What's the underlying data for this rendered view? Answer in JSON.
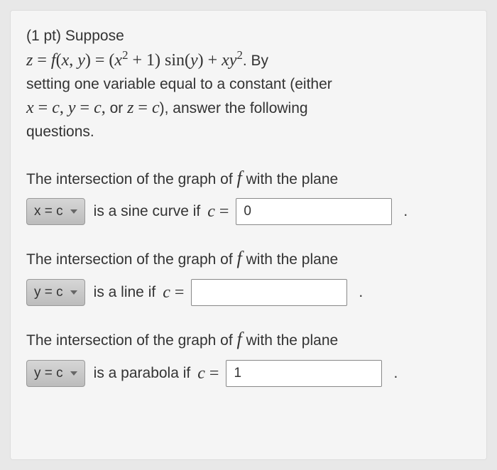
{
  "problem": {
    "prefix": "(1 pt) Suppose",
    "equation_display": "z = f(x, y) = (x² + 1) sin(y) + xy²",
    "after_eq": ". By",
    "line2a": "setting one variable equal to a constant (either",
    "constants_text": "x = c, y = c, or z = c",
    "line2b": "), answer the following",
    "line3": "questions."
  },
  "questions": [
    {
      "intro_a": "The intersection of the graph of ",
      "intro_b": " with the plane",
      "dropdown": "x = c",
      "condition": "is a sine curve if ",
      "c_eq": "c =",
      "value": "0"
    },
    {
      "intro_a": "The intersection of the graph of ",
      "intro_b": " with the plane",
      "dropdown": "y = c",
      "condition": "is a line if ",
      "c_eq": "c =",
      "value": ""
    },
    {
      "intro_a": "The intersection of the graph of ",
      "intro_b": " with the plane",
      "dropdown": "y = c",
      "condition": "is a parabola if ",
      "c_eq": "c =",
      "value": "1"
    }
  ]
}
